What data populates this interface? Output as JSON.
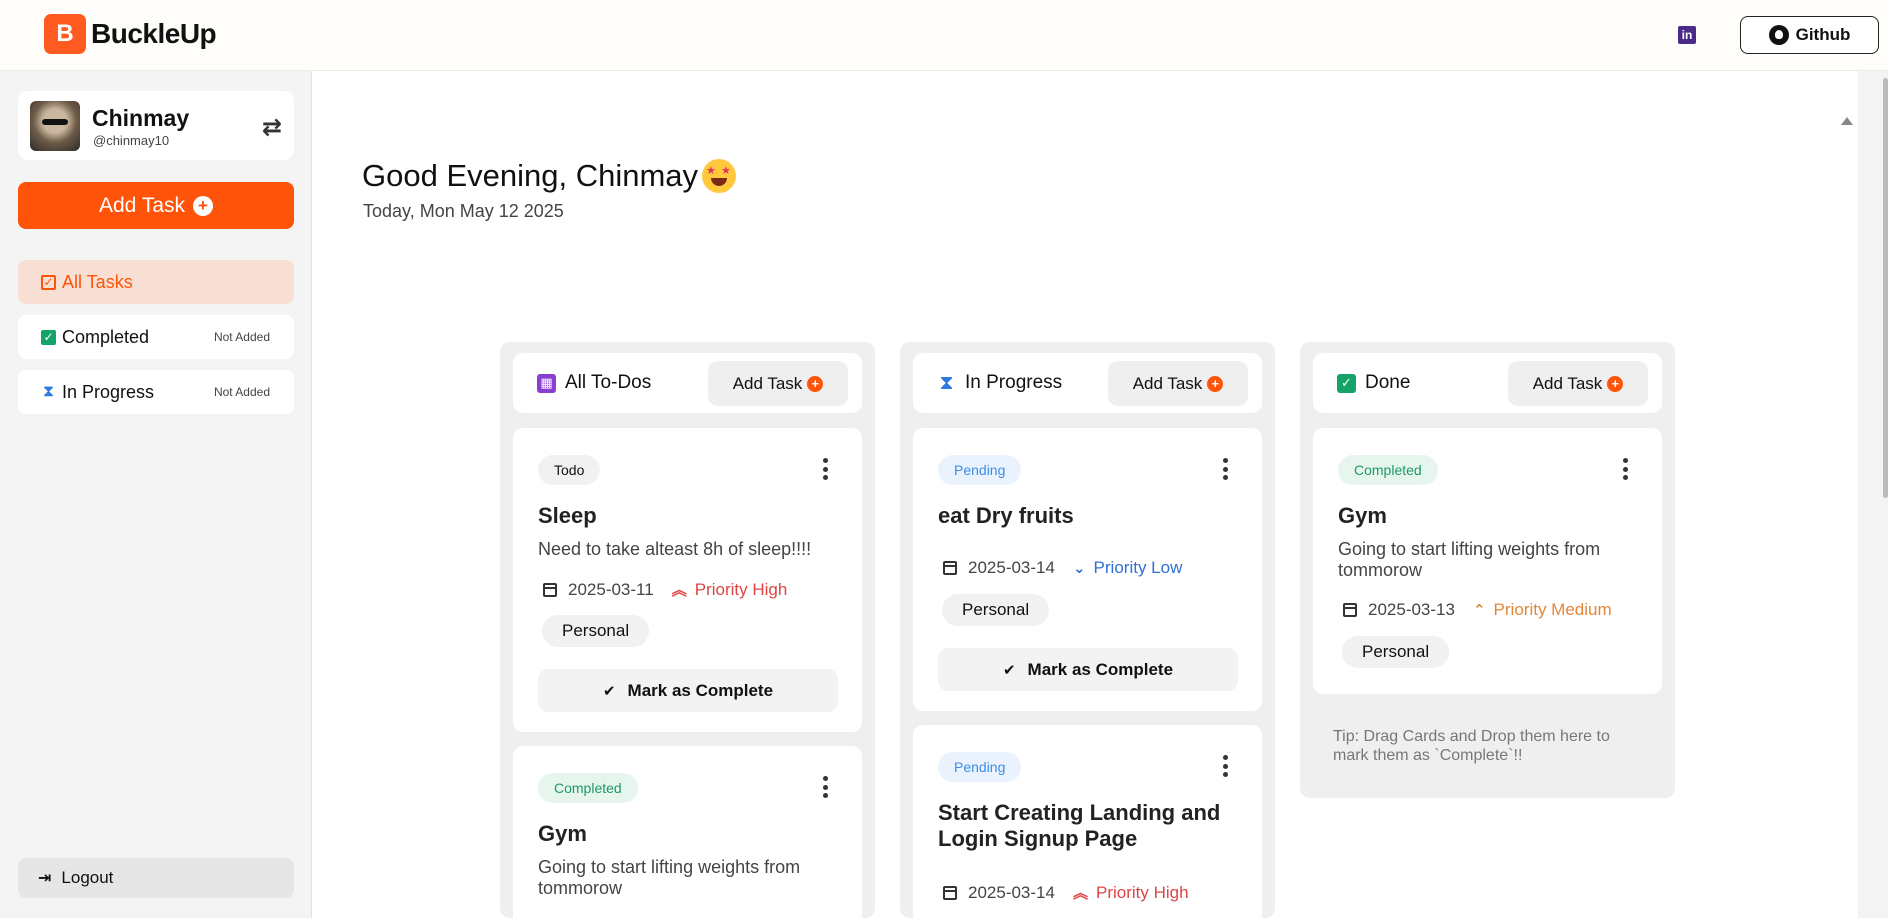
{
  "header": {
    "logo_letter": "B",
    "app_name": "BuckleUp",
    "linkedin_icon": "linkedin-icon",
    "github_label": "Github"
  },
  "sidebar": {
    "profile": {
      "name": "Chinmay",
      "handle": "@chinmay10"
    },
    "add_task_label": "Add Task",
    "nav": [
      {
        "label": "All Tasks",
        "icon": "calendar-check-icon",
        "badge": ""
      },
      {
        "label": "Completed",
        "icon": "check-square-icon",
        "badge": "Not Added"
      },
      {
        "label": "In Progress",
        "icon": "hourglass-icon",
        "badge": "Not Added"
      }
    ],
    "logout_label": "Logout"
  },
  "main": {
    "greeting": "Good Evening, Chinmay",
    "date": "Today, Mon May 12 2025",
    "columns": [
      {
        "title": "All To-Dos",
        "icon": "calendar-icon",
        "add_label": "Add Task",
        "cards": [
          {
            "tag": "Todo",
            "title": "Sleep",
            "description": "Need to take alteast 8h of sleep!!!!",
            "date": "2025-03-11",
            "priority": "Priority High",
            "category": "Personal",
            "action": "Mark as Complete"
          },
          {
            "tag": "Completed",
            "title": "Gym",
            "description": "Going to start lifting weights from tommorow"
          }
        ]
      },
      {
        "title": "In Progress",
        "icon": "hourglass-icon",
        "add_label": "Add Task",
        "cards": [
          {
            "tag": "Pending",
            "title": "eat Dry fruits",
            "date": "2025-03-14",
            "priority": "Priority Low",
            "category": "Personal",
            "action": "Mark as Complete"
          },
          {
            "tag": "Pending",
            "title": "Start Creating Landing and Login Signup Page",
            "date": "2025-03-14",
            "priority": "Priority High"
          }
        ]
      },
      {
        "title": "Done",
        "icon": "check-square-icon",
        "add_label": "Add Task",
        "cards": [
          {
            "tag": "Completed",
            "title": "Gym",
            "description": "Going to start lifting weights from tommorow",
            "date": "2025-03-13",
            "priority": "Priority Medium",
            "category": "Personal"
          }
        ],
        "tip": "Tip: Drag Cards and Drop them here to mark them as `Complete`!!"
      }
    ]
  },
  "colors": {
    "accent": "#ff5309",
    "priority_high": "#e04545",
    "priority_low": "#2f6fd6",
    "priority_medium": "#e0883a",
    "completed_green": "#1c9a65",
    "pending_blue": "#3b8de6"
  }
}
